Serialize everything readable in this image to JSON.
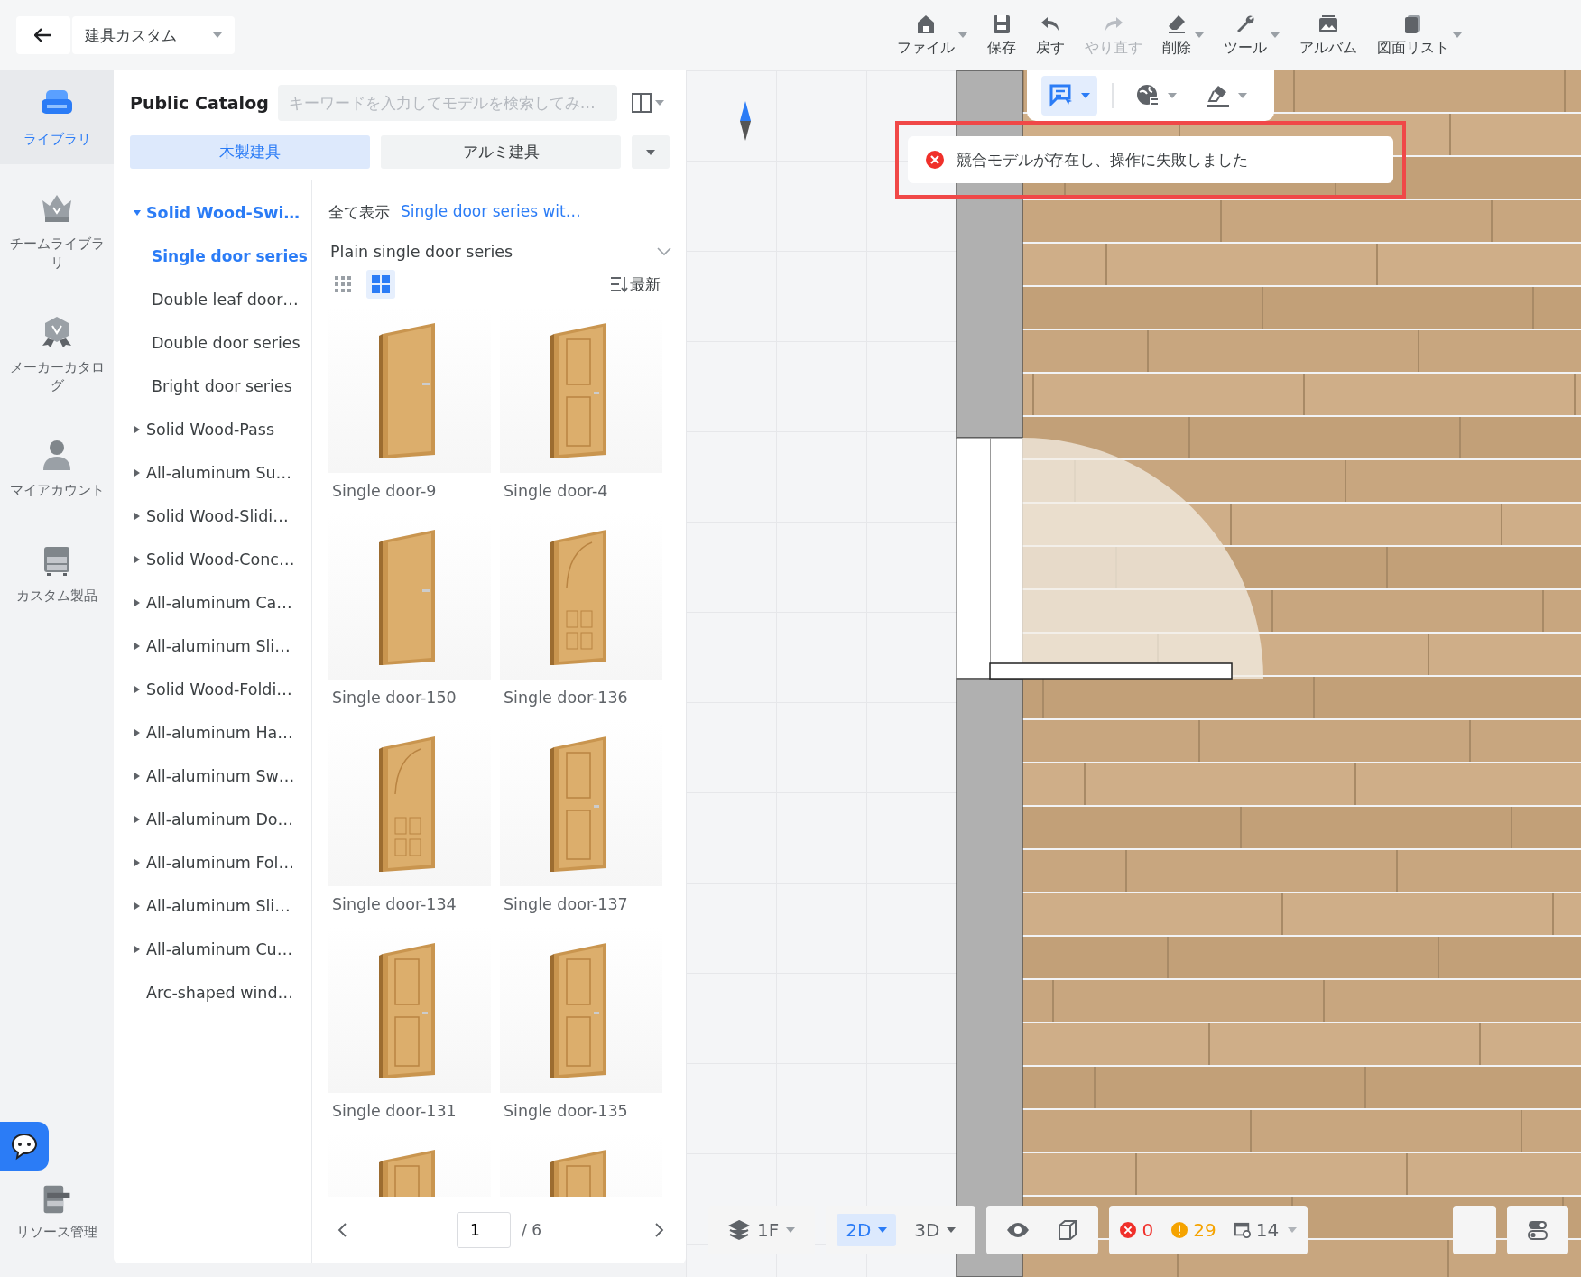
{
  "top_bar": {
    "project_name": "建具カスタム",
    "tools": [
      {
        "label": "ファイル",
        "kind": "house",
        "dropdown": true,
        "disabled": false
      },
      {
        "label": "保存",
        "kind": "floppy",
        "dropdown": false,
        "disabled": false
      },
      {
        "label": "戻す",
        "kind": "undo",
        "dropdown": false,
        "disabled": false
      },
      {
        "label": "やり直す",
        "kind": "redo",
        "dropdown": false,
        "disabled": true
      },
      {
        "label": "削除",
        "kind": "eraser",
        "dropdown": true,
        "disabled": false
      },
      {
        "label": "ツール",
        "kind": "wrench",
        "dropdown": true,
        "disabled": false
      },
      {
        "label": "アルバム",
        "kind": "album",
        "dropdown": false,
        "disabled": false
      },
      {
        "label": "図面リスト",
        "kind": "pages",
        "dropdown": true,
        "disabled": false
      }
    ]
  },
  "nav": {
    "items": [
      {
        "label": "ライブラリ",
        "kind": "sofa",
        "selected": true
      },
      {
        "label": "チームライブラリ",
        "kind": "crown",
        "selected": false
      },
      {
        "label": "メーカーカタログ",
        "kind": "badge",
        "selected": false
      },
      {
        "label": "マイアカウント",
        "kind": "person",
        "selected": false
      },
      {
        "label": "カスタム製品",
        "kind": "cabinet",
        "selected": false
      }
    ],
    "footer": {
      "label": "リソース管理"
    }
  },
  "catalog": {
    "title": "Public Catalog",
    "search": {
      "placeholder": "キーワードを入力してモデルを検索してみ…"
    },
    "tabs": [
      {
        "label": "木製建具",
        "selected": true
      },
      {
        "label": "アルミ建具",
        "selected": false
      }
    ],
    "tree": [
      {
        "label": "Solid Wood-Swi…",
        "kind": "folder",
        "expanded": true,
        "children": [
          {
            "label": "Single door series",
            "selected": true
          },
          {
            "label": "Double leaf door…",
            "selected": false
          },
          {
            "label": "Double door series",
            "selected": false
          },
          {
            "label": "Bright door series",
            "selected": false
          }
        ]
      },
      {
        "label": "Solid Wood-Pass",
        "kind": "folder",
        "expanded": false
      },
      {
        "label": "All-aluminum Su…",
        "kind": "folder",
        "expanded": false
      },
      {
        "label": "Solid Wood-Slidi…",
        "kind": "folder",
        "expanded": false
      },
      {
        "label": "Solid Wood-Conc…",
        "kind": "folder",
        "expanded": false
      },
      {
        "label": "All-aluminum Ca…",
        "kind": "folder",
        "expanded": false
      },
      {
        "label": "All-aluminum Sli…",
        "kind": "folder",
        "expanded": false
      },
      {
        "label": "Solid Wood-Foldi…",
        "kind": "folder",
        "expanded": false
      },
      {
        "label": "All-aluminum Ha…",
        "kind": "folder",
        "expanded": false
      },
      {
        "label": "All-aluminum Sw…",
        "kind": "folder",
        "expanded": false
      },
      {
        "label": "All-aluminum Do…",
        "kind": "folder",
        "expanded": false
      },
      {
        "label": "All-aluminum Fol…",
        "kind": "folder",
        "expanded": false
      },
      {
        "label": "All-aluminum Sli…",
        "kind": "folder",
        "expanded": false
      },
      {
        "label": "All-aluminum Cu…",
        "kind": "folder",
        "expanded": false
      },
      {
        "label": "Arc-shaped wind…",
        "kind": "leaf",
        "expanded": false
      }
    ],
    "breadcrumb": {
      "root": "全て表示",
      "current": "Single door series wit…"
    },
    "series_select": "Plain single door series",
    "view_modes": [
      {
        "kind": "small",
        "selected": false
      },
      {
        "kind": "large",
        "selected": true
      }
    ],
    "sort": "最新",
    "items": [
      {
        "name": "Single door-9",
        "kind": "plain"
      },
      {
        "name": "Single door-4",
        "kind": "panel"
      },
      {
        "name": "Single door-150",
        "kind": "plain"
      },
      {
        "name": "Single door-136",
        "kind": "arch"
      },
      {
        "name": "Single door-134",
        "kind": "arch"
      },
      {
        "name": "Single door-137",
        "kind": "panel"
      },
      {
        "name": "Single door-131",
        "kind": "panel"
      },
      {
        "name": "Single door-135",
        "kind": "panel"
      },
      {
        "kind": "panel"
      },
      {
        "kind": "panel"
      }
    ],
    "pagination": {
      "page": "1",
      "total": "/ 6"
    }
  },
  "canvas_toolbar": [
    {
      "kind": "select",
      "selected": true
    },
    {
      "kind": "globe",
      "selected": false
    },
    {
      "kind": "brush",
      "selected": false
    }
  ],
  "toast": {
    "message": "競合モデルが存在し、操作に失敗しました"
  },
  "bottom_bar": {
    "floor": "1F",
    "views": [
      {
        "label": "2D",
        "selected": true
      },
      {
        "label": "3D",
        "selected": false
      }
    ],
    "errors": "0",
    "warnings": "29",
    "count": "14"
  }
}
